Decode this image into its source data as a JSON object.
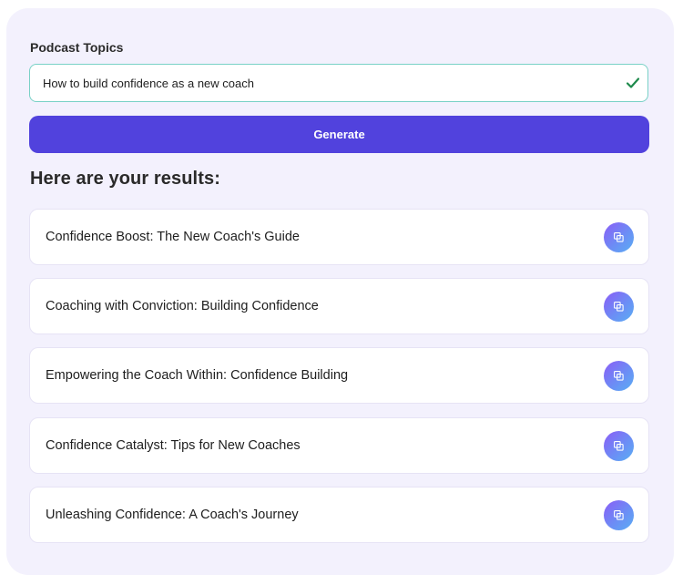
{
  "form": {
    "topics_label": "Podcast Topics",
    "topics_value": "How to build confidence as a new coach",
    "generate_label": "Generate"
  },
  "results": {
    "heading": "Here are your results:",
    "items": [
      {
        "title": "Confidence Boost: The New Coach's Guide",
        "icon": "copy-icon"
      },
      {
        "title": "Coaching with Conviction: Building Confidence",
        "icon": "copy-icon"
      },
      {
        "title": "Empowering the Coach Within: Confidence Building",
        "icon": "copy-icon"
      },
      {
        "title": "Confidence Catalyst: Tips for New Coaches",
        "icon": "copy-icon"
      },
      {
        "title": "Unleashing Confidence: A Coach's Journey",
        "icon": "copy-icon"
      }
    ]
  },
  "colors": {
    "panel_bg": "#f3f1fd",
    "primary": "#5142dd",
    "input_border": "#79d1c6",
    "check": "#1f8a4c"
  }
}
